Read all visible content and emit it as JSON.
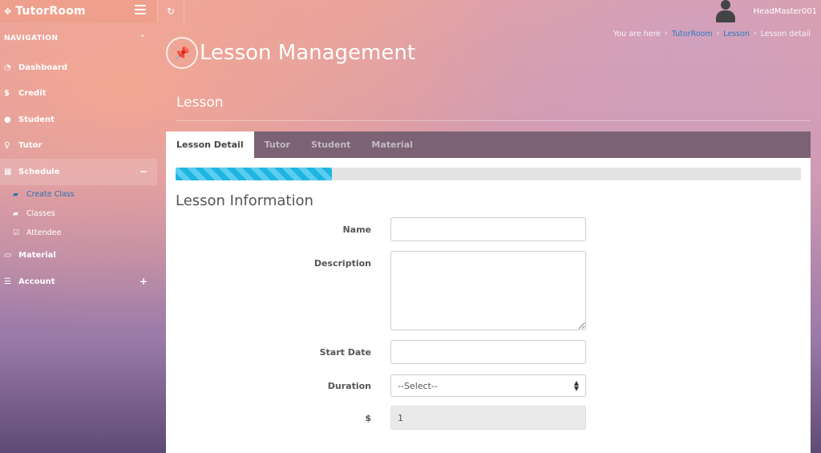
{
  "app": {
    "brand": "TutorRoom",
    "username": "HeadMaster001"
  },
  "sidebar": {
    "header": "NAVIGATION",
    "items": [
      {
        "label": "Dashboard",
        "icon": "dashboard-icon"
      },
      {
        "label": "Credit",
        "icon": "dollar-icon"
      },
      {
        "label": "Student",
        "icon": "user-icon"
      },
      {
        "label": "Tutor",
        "icon": "male-icon"
      },
      {
        "label": "Schedule",
        "icon": "calendar-icon"
      },
      {
        "label": "Material",
        "icon": "folder-icon"
      },
      {
        "label": "Account",
        "icon": "list-icon"
      }
    ],
    "schedule_subitems": [
      {
        "label": "Create Class",
        "icon": "book-icon"
      },
      {
        "label": "Classes",
        "icon": "book-icon"
      },
      {
        "label": "Attendee",
        "icon": "check-square-icon"
      }
    ]
  },
  "breadcrumb": {
    "prefix": "You are here",
    "items": [
      "TutorRoom",
      "Lesson",
      "Lesson detail"
    ]
  },
  "page": {
    "title": "Lesson Management",
    "section": "Lesson"
  },
  "tabs": [
    "Lesson Detail",
    "Tutor",
    "Student",
    "Material"
  ],
  "progress": {
    "percent": 25
  },
  "form": {
    "heading": "Lesson Information",
    "name_label": "Name",
    "name_value": "",
    "description_label": "Description",
    "description_value": "",
    "start_date_label": "Start Date",
    "start_date_value": "",
    "duration_label": "Duration",
    "duration_value": "--Select--",
    "price_label": "$",
    "price_value": "1"
  },
  "colors": {
    "link": "#2f7cc7",
    "progress": "#1fb5e0",
    "tab_bar": "#7b6274"
  }
}
